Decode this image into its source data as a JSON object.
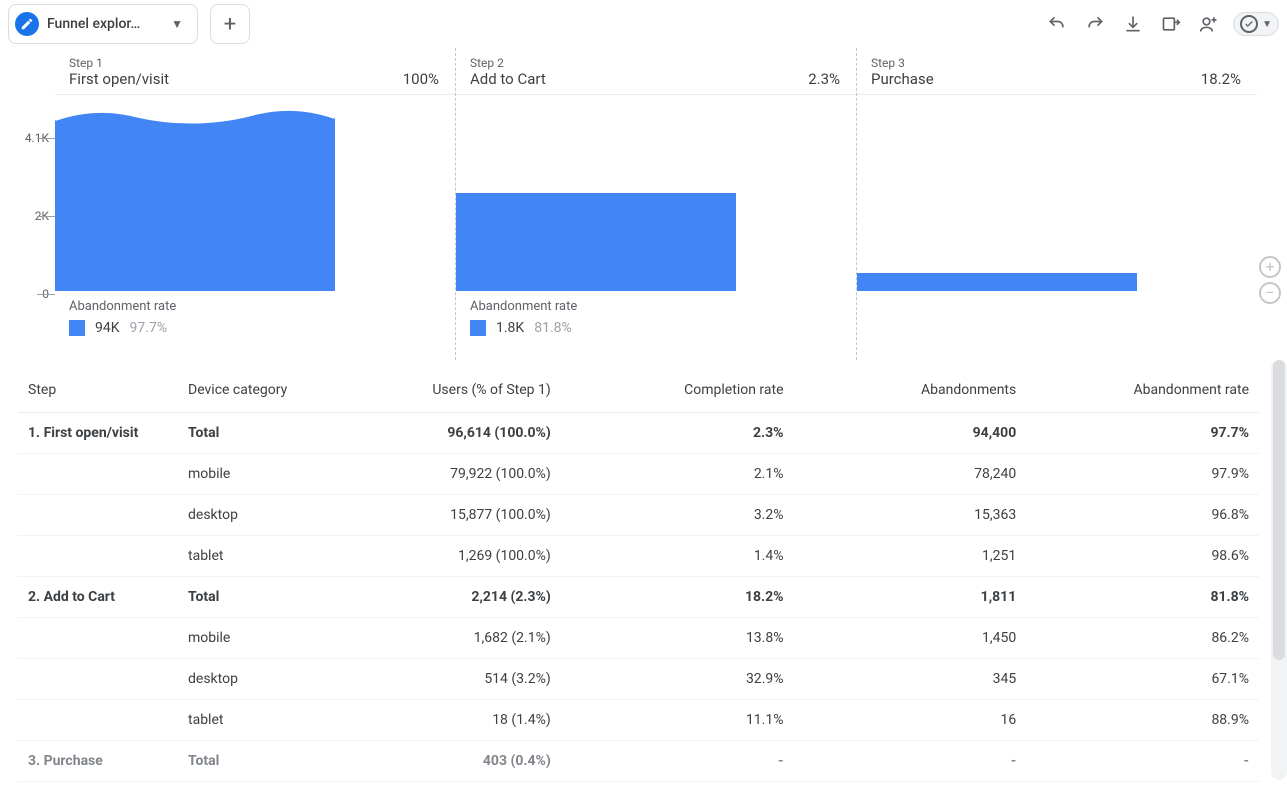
{
  "tab": {
    "title": "Funnel explor…"
  },
  "chart_data": {
    "type": "bar",
    "ylabel": "",
    "ylim": [
      0,
      4100
    ],
    "ticks": [
      "4.1K",
      "2K",
      "0"
    ],
    "steps": [
      {
        "step_label": "Step 1",
        "name": "First open/visit",
        "completion_pct": "100%",
        "users": 4100,
        "abandonment_label": "Abandonment rate",
        "abandon_count": "94K",
        "abandon_pct": "97.7%"
      },
      {
        "step_label": "Step 2",
        "name": "Add to Cart",
        "completion_pct": "2.3%",
        "users": 2214,
        "abandonment_label": "Abandonment rate",
        "abandon_count": "1.8K",
        "abandon_pct": "81.8%"
      },
      {
        "step_label": "Step 3",
        "name": "Purchase",
        "completion_pct": "18.2%",
        "users": 403
      }
    ]
  },
  "table": {
    "headers": {
      "step": "Step",
      "device": "Device category",
      "users": "Users (% of Step 1)",
      "completion": "Completion rate",
      "abandonments": "Abandonments",
      "rate": "Abandonment rate"
    },
    "rows": [
      {
        "step": "1. First open/visit",
        "device": "Total",
        "users": "96,614 (100.0%)",
        "completion": "2.3%",
        "abandonments": "94,400",
        "rate": "97.7%",
        "total": true
      },
      {
        "step": "",
        "device": "mobile",
        "users": "79,922 (100.0%)",
        "completion": "2.1%",
        "abandonments": "78,240",
        "rate": "97.9%"
      },
      {
        "step": "",
        "device": "desktop",
        "users": "15,877 (100.0%)",
        "completion": "3.2%",
        "abandonments": "15,363",
        "rate": "96.8%"
      },
      {
        "step": "",
        "device": "tablet",
        "users": "1,269 (100.0%)",
        "completion": "1.4%",
        "abandonments": "1,251",
        "rate": "98.6%"
      },
      {
        "step": "2. Add to Cart",
        "device": "Total",
        "users": "2,214 (2.3%)",
        "completion": "18.2%",
        "abandonments": "1,811",
        "rate": "81.8%",
        "total": true
      },
      {
        "step": "",
        "device": "mobile",
        "users": "1,682 (2.1%)",
        "completion": "13.8%",
        "abandonments": "1,450",
        "rate": "86.2%"
      },
      {
        "step": "",
        "device": "desktop",
        "users": "514 (3.2%)",
        "completion": "32.9%",
        "abandonments": "345",
        "rate": "67.1%"
      },
      {
        "step": "",
        "device": "tablet",
        "users": "18 (1.4%)",
        "completion": "11.1%",
        "abandonments": "16",
        "rate": "88.9%"
      },
      {
        "step": "3. Purchase",
        "device": "Total",
        "users": "403 (0.4%)",
        "completion": "-",
        "abandonments": "-",
        "rate": "-",
        "total": true,
        "muted": true
      }
    ]
  }
}
